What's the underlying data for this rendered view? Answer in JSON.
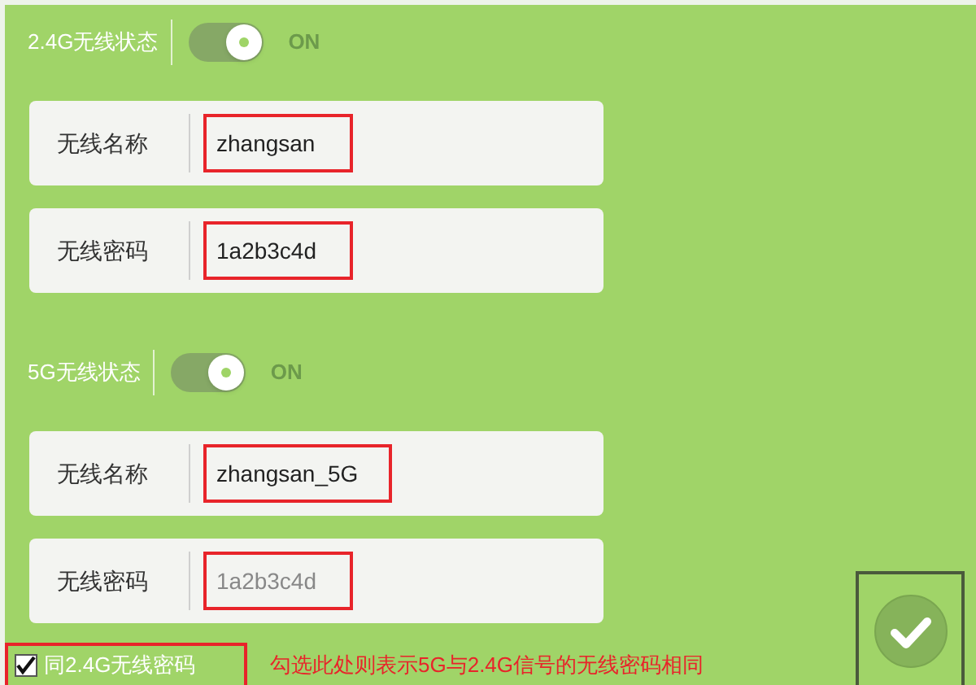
{
  "sections": [
    {
      "status_label": "2.4G无线状态",
      "switch": {
        "on": true,
        "label": "ON"
      },
      "fields": [
        {
          "label": "无线名称",
          "value": "zhangsan",
          "disabled": false
        },
        {
          "label": "无线密码",
          "value": "1a2b3c4d",
          "disabled": false
        }
      ]
    },
    {
      "status_label": "5G无线状态",
      "switch": {
        "on": true,
        "label": "ON"
      },
      "fields": [
        {
          "label": "无线名称",
          "value": "zhangsan_5G",
          "disabled": false
        },
        {
          "label": "无线密码",
          "value": "1a2b3c4d",
          "disabled": true
        }
      ]
    }
  ],
  "same_password": {
    "label": "同2.4G无线密码",
    "checked": true
  },
  "note": "勾选此处则表示5G与2.4G信号的无线密码相同"
}
